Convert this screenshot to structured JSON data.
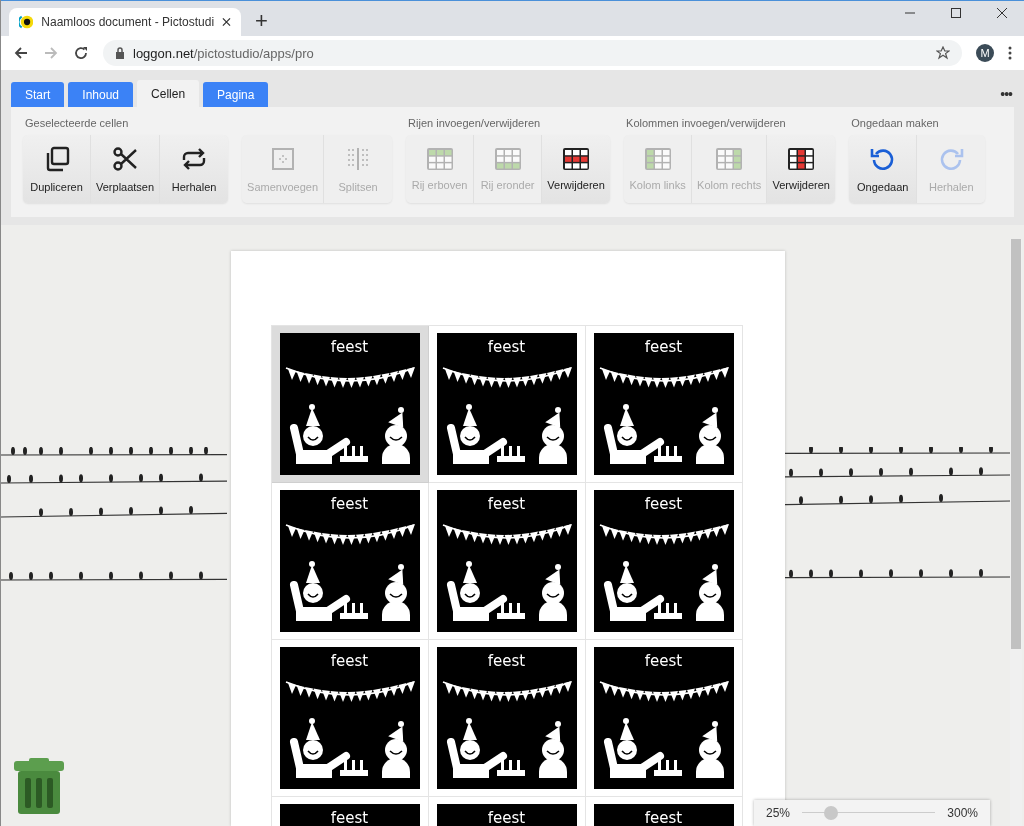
{
  "browser": {
    "tab_title": "Naamloos document - Pictostudi",
    "new_tab": "+",
    "url_host": "loggon.net",
    "url_path": "/pictostudio/apps/pro",
    "profile_initial": "M"
  },
  "app_tabs": [
    {
      "label": "Start",
      "selected": false
    },
    {
      "label": "Inhoud",
      "selected": false
    },
    {
      "label": "Cellen",
      "selected": true
    },
    {
      "label": "Pagina",
      "selected": false
    }
  ],
  "more_menu": "•••",
  "ribbon_groups": [
    {
      "title": "Geselecteerde cellen",
      "buttons": [
        {
          "label": "Dupliceren",
          "kind": "duplicate",
          "disabled": false
        },
        {
          "label": "Verplaatsen",
          "kind": "scissors",
          "disabled": false
        },
        {
          "label": "Herhalen",
          "kind": "repeat",
          "disabled": false
        }
      ]
    },
    {
      "buttons": [
        {
          "label": "Samenvoegen",
          "kind": "merge",
          "disabled": true
        },
        {
          "label": "Splitsen",
          "kind": "split",
          "disabled": true
        }
      ]
    },
    {
      "title": "Rijen invoegen/verwijderen",
      "buttons": [
        {
          "label": "Rij erboven",
          "kind": "row-above",
          "disabled": true
        },
        {
          "label": "Rij eronder",
          "kind": "row-below",
          "disabled": true
        },
        {
          "label": "Verwijderen",
          "kind": "row-delete",
          "disabled": false
        }
      ]
    },
    {
      "title": "Kolommen invoegen/verwijderen",
      "buttons": [
        {
          "label": "Kolom links",
          "kind": "col-left",
          "disabled": true
        },
        {
          "label": "Kolom rechts",
          "kind": "col-right",
          "disabled": true
        },
        {
          "label": "Verwijderen",
          "kind": "col-delete",
          "disabled": false
        }
      ]
    },
    {
      "title": "Ongedaan maken",
      "buttons": [
        {
          "label": "Ongedaan",
          "kind": "undo",
          "disabled": false
        },
        {
          "label": "Herhalen",
          "kind": "redo",
          "disabled": true
        }
      ]
    }
  ],
  "grid_rows": [
    [
      {
        "label": "feest",
        "selected": true
      },
      {
        "label": "feest",
        "selected": false
      },
      {
        "label": "feest",
        "selected": false
      }
    ],
    [
      {
        "label": "feest",
        "selected": false
      },
      {
        "label": "feest",
        "selected": false
      },
      {
        "label": "feest",
        "selected": false
      }
    ],
    [
      {
        "label": "feest",
        "selected": false
      },
      {
        "label": "feest",
        "selected": false
      },
      {
        "label": "feest",
        "selected": false
      }
    ],
    [
      {
        "label": "feest",
        "selected": false
      },
      {
        "label": "feest",
        "selected": false
      },
      {
        "label": "feest",
        "selected": false
      }
    ]
  ],
  "zoom": {
    "min_label": "25%",
    "max_label": "300%",
    "level": 0.22
  }
}
